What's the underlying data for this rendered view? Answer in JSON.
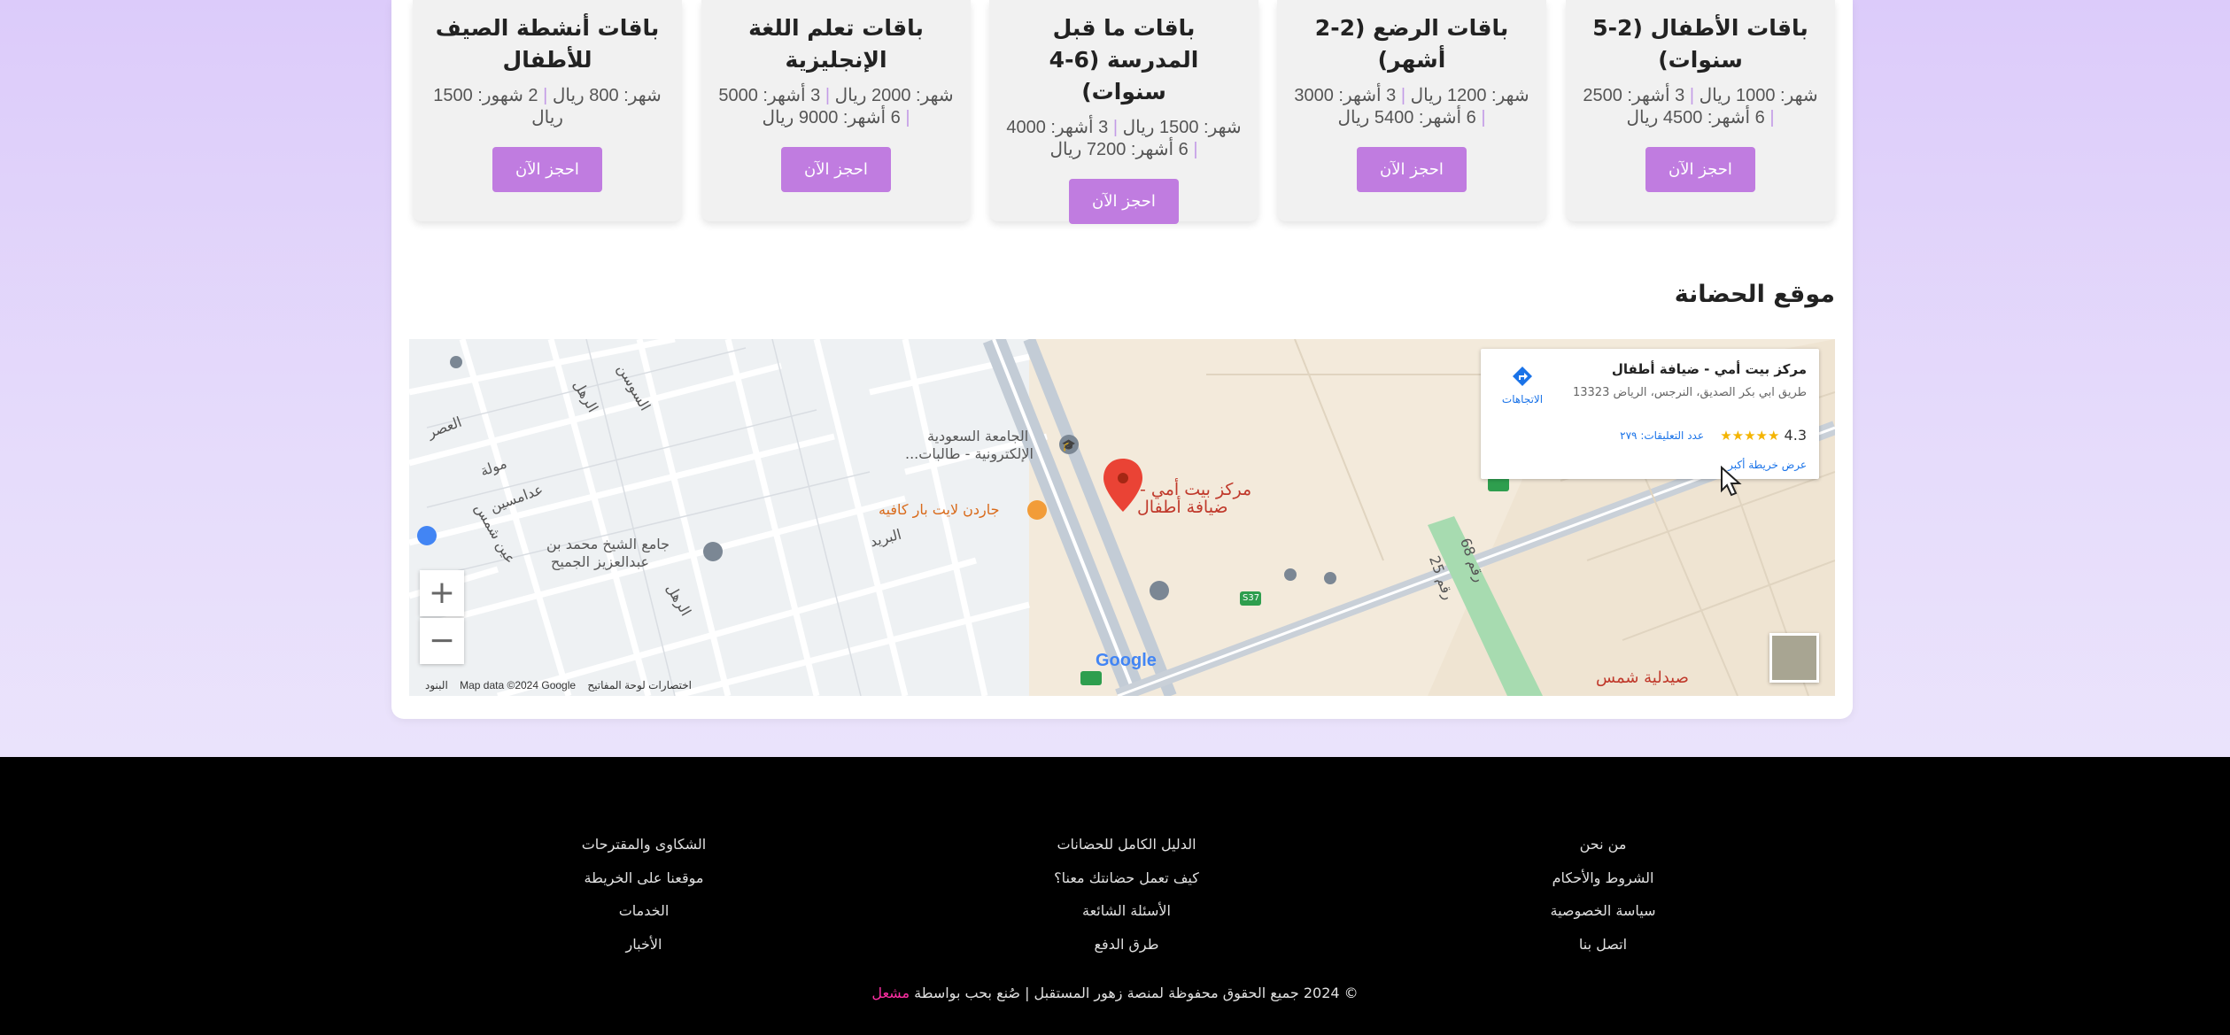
{
  "packages": [
    {
      "title": "باقات الأطفال (2-5 سنوات)",
      "prices": [
        "شهر: 1000 ريال",
        "3 أشهر: 2500",
        "6 أشهر: 4500 ريال"
      ],
      "button": "احجز الآن"
    },
    {
      "title": "باقات الرضع (2-2 أشهر)",
      "prices": [
        "شهر: 1200 ريال",
        "3 أشهر: 3000",
        "6 أشهر: 5400 ريال"
      ],
      "button": "احجز الآن"
    },
    {
      "title": "باقات ما قبل المدرسة (6-4 سنوات)",
      "prices": [
        "شهر: 1500 ريال",
        "3 أشهر: 4000",
        "6 أشهر: 7200 ريال"
      ],
      "button": "احجز الآن"
    },
    {
      "title": "باقات تعلم اللغة الإنجليزية",
      "prices": [
        "شهر: 2000 ريال",
        "3 أشهر: 5000",
        "6 أشهر: 9000 ريال"
      ],
      "button": "احجز الآن"
    },
    {
      "title": "باقات أنشطة الصيف للأطفال",
      "prices": [
        "شهر: 800 ريال",
        "2 شهور: 1500 ريال"
      ],
      "button": "احجز الآن"
    }
  ],
  "location": {
    "title": "موقع الحضانة",
    "map": {
      "place_name": "مركز بيت أمي - ضيافة أطفال",
      "address": "طريق ابي بكر الصديق، النرجس، الرياض 13323",
      "rating": "4.3",
      "stars": "★★★★★",
      "reviews": "عدد التعليقات: ٢٧٩",
      "view_larger": "عرض خريطة أكبر",
      "directions": "الاتجاهات",
      "marker_label_1": "مركز بيت أمي -",
      "marker_label_2": "ضيافة أطفال",
      "labels": {
        "university_1": "الجامعة السعودية",
        "university_2": "الإلكترونية - طالبات...",
        "cafe": "جاردن لايت بار كافيه",
        "mosque_1": "جامع الشيخ محمد بن",
        "mosque_2": "عبدالعزيز الجميح",
        "street_albarid": "البريد",
        "street_alrahl": "الرهل",
        "street_alsusan": "السوسن",
        "street_adamsin": "عدامسين",
        "street_mawla": "مولة",
        "street_aqeel": "عين شمس",
        "street_alasr": "العصر",
        "street_alrahl2": "الرهل",
        "street_68": "رقم 68",
        "street_25": "رقم 25",
        "road_s37": "S37",
        "pharmacy": "صيدلية شمس"
      },
      "zoom_in": "+",
      "zoom_out": "−",
      "google": "Google",
      "attribution_shortcuts": "اختصارات لوحة المفاتيح",
      "attribution_data": "Map data ©2024 Google",
      "attribution_terms": "البنود"
    }
  },
  "footer": {
    "col1": [
      "من نحن",
      "الشروط والأحكام",
      "سياسة الخصوصية",
      "اتصل بنا"
    ],
    "col2": [
      "الدليل الكامل للحضانات",
      "كيف تعمل حضانتك معنا؟",
      "الأسئلة الشائعة",
      "طرق الدفع"
    ],
    "col3": [
      "الشكاوى والمقترحات",
      "موقعنا على الخريطة",
      "الخدمات",
      "الأخبار"
    ],
    "copyright": "© 2024 جميع الحقوق محفوظة لمنصة زهور المستقبل | صُنع بحب بواسطة",
    "brand": "مشعل"
  },
  "colors": {
    "accent": "#c07ce0",
    "brand_pink": "#ff2fa4",
    "marker": "#ea4335"
  }
}
